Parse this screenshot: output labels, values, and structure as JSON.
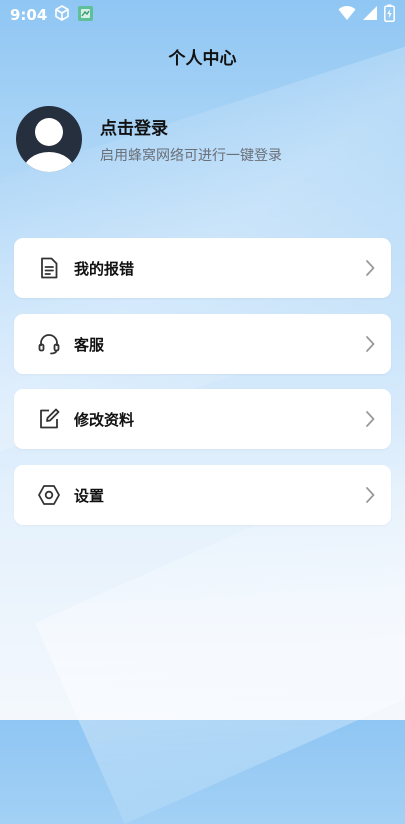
{
  "status_bar": {
    "time": "9:04"
  },
  "header": {
    "title": "个人中心"
  },
  "profile": {
    "title": "点击登录",
    "subtitle": "启用蜂窝网络可进行一键登录"
  },
  "menu": [
    {
      "label": "我的报错",
      "icon": "document-icon"
    },
    {
      "label": "客服",
      "icon": "headset-icon"
    },
    {
      "label": "修改资料",
      "icon": "edit-icon"
    },
    {
      "label": "设置",
      "icon": "settings-icon"
    }
  ],
  "colors": {
    "background_top": "#8fc6f3",
    "background_bottom": "#f4f8fd",
    "card": "#ffffff",
    "avatar": "#252f3e"
  }
}
